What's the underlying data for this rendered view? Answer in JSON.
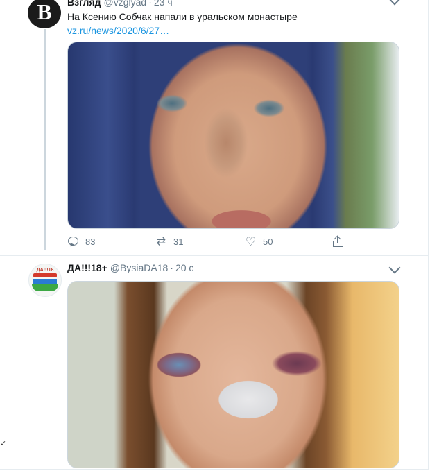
{
  "tweets": [
    {
      "avatar_letter": "B",
      "name": "Взгляд",
      "handle": "@vzglyad",
      "separator": "·",
      "time": "23 ч",
      "text": "На Ксению Собчак напали в уральском монастыре",
      "link": "vz.ru/news/2020/6/27…",
      "stats": {
        "replies": "83",
        "retweets": "31",
        "likes": "50"
      }
    },
    {
      "avatar_text": "ДА!!!18",
      "name": "ДА!!!18+",
      "handle": "@BysiaDA18",
      "separator": "·",
      "time": "20 с"
    }
  ],
  "icons": {
    "more": "chevron-down-icon",
    "reply": "reply-icon",
    "retweet": "retweet-icon",
    "like": "heart-icon",
    "share": "share-icon"
  },
  "colors": {
    "link": "#1b95e0",
    "secondary_text": "#657786",
    "border": "#e6ecf0"
  }
}
